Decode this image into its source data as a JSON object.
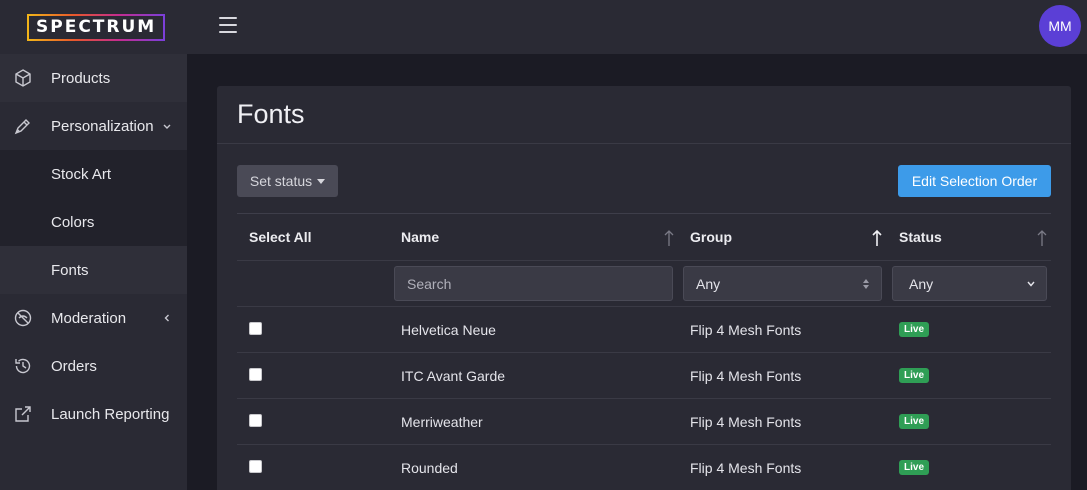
{
  "brand": {
    "logo_text": "SPECTRUM"
  },
  "topbar": {
    "avatar_initials": "MM"
  },
  "sidebar": {
    "items": [
      {
        "label": "Products",
        "icon": "cube-icon"
      },
      {
        "label": "Personalization",
        "icon": "pen-icon",
        "expanded": true
      },
      {
        "label": "Stock Art"
      },
      {
        "label": "Colors"
      },
      {
        "label": "Fonts",
        "active": true
      },
      {
        "label": "Moderation",
        "icon": "eye-slash-icon"
      },
      {
        "label": "Orders",
        "icon": "history-icon"
      },
      {
        "label": "Launch Reporting",
        "icon": "external-link-icon"
      }
    ]
  },
  "page": {
    "title": "Fonts",
    "set_status_label": "Set status",
    "edit_order_label": "Edit Selection Order"
  },
  "table": {
    "select_all": "Select All",
    "columns": {
      "name": "Name",
      "group": "Group",
      "status": "Status"
    },
    "filters": {
      "search_placeholder": "Search",
      "group_value": "Any",
      "status_value": "Any"
    },
    "rows": [
      {
        "name": "Helvetica Neue",
        "group": "Flip 4 Mesh Fonts",
        "status": "Live"
      },
      {
        "name": "ITC Avant Garde",
        "group": "Flip 4 Mesh Fonts",
        "status": "Live"
      },
      {
        "name": "Merriweather",
        "group": "Flip 4 Mesh Fonts",
        "status": "Live"
      },
      {
        "name": "Rounded",
        "group": "Flip 4 Mesh Fonts",
        "status": "Live"
      }
    ]
  },
  "colors": {
    "accent": "#3d9be9",
    "live_badge": "#2f9e55",
    "avatar": "#5b3fd6",
    "select_all": "#8a9bf2"
  }
}
